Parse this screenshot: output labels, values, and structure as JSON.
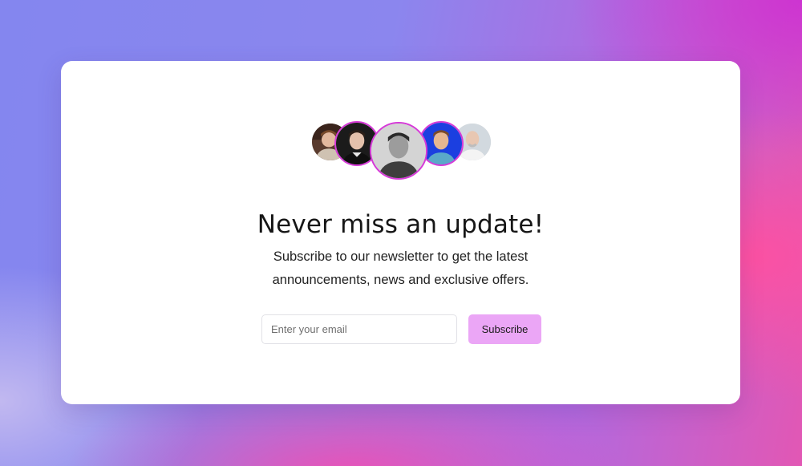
{
  "newsletter": {
    "title": "Never miss an update!",
    "description": "Subscribe to our newsletter to get the latest announcements, news and exclusive offers.",
    "email_placeholder": "Enter your email",
    "email_value": "",
    "subscribe_label": "Subscribe"
  },
  "avatars": [
    {
      "name": "avatar-1",
      "bg": "#6b4a3a"
    },
    {
      "name": "avatar-2",
      "bg": "#1e1e1e"
    },
    {
      "name": "avatar-3",
      "bg": "#d9d9d9"
    },
    {
      "name": "avatar-4",
      "bg": "#1b3fe0"
    },
    {
      "name": "avatar-5",
      "bg": "#d7dde3"
    }
  ],
  "colors": {
    "card_background": "#ffffff",
    "button_background": "#eba6f6",
    "avatar_ring": "#d63ad8",
    "text_primary": "#161616"
  }
}
